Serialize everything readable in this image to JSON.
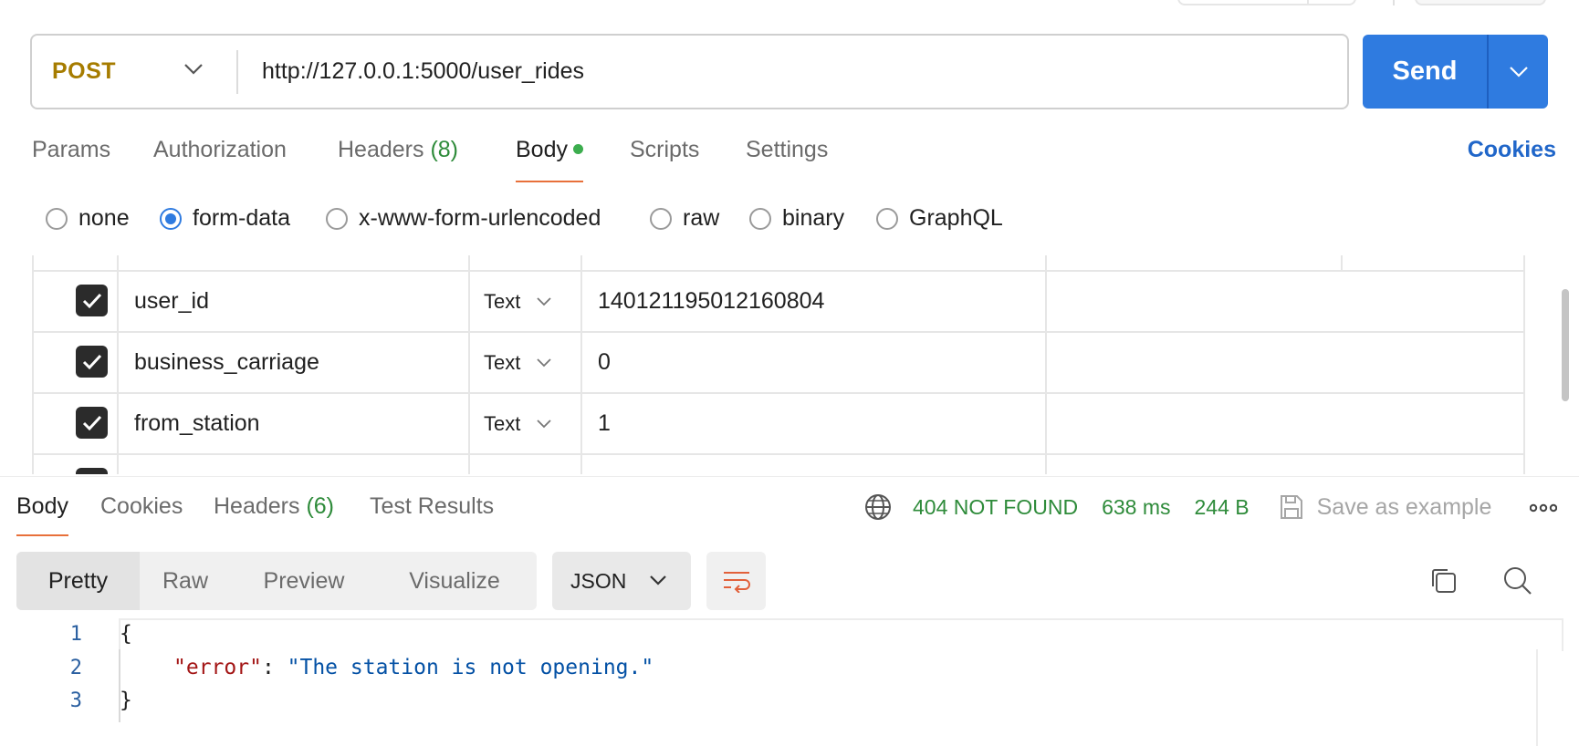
{
  "request": {
    "method": "POST",
    "url": "http://127.0.0.1:5000/user_rides",
    "send_label": "Send"
  },
  "req_tabs": {
    "params": "Params",
    "authorization": "Authorization",
    "headers": "Headers",
    "headers_count": "(8)",
    "body": "Body",
    "scripts": "Scripts",
    "settings": "Settings",
    "cookies": "Cookies"
  },
  "body_types": {
    "none": "none",
    "form_data": "form-data",
    "urlencoded": "x-www-form-urlencoded",
    "raw": "raw",
    "binary": "binary",
    "graphql": "GraphQL",
    "selected": "form-data"
  },
  "form_rows": [
    {
      "key": "user_id",
      "type": "Text",
      "value": "140121195012160804",
      "checked": true
    },
    {
      "key": "business_carriage",
      "type": "Text",
      "value": "0",
      "checked": true
    },
    {
      "key": "from_station",
      "type": "Text",
      "value": "1",
      "checked": true
    }
  ],
  "response": {
    "tabs": {
      "body": "Body",
      "cookies": "Cookies",
      "headers": "Headers",
      "headers_count": "(6)",
      "test_results": "Test Results"
    },
    "status": "404 NOT FOUND",
    "time": "638 ms",
    "size": "244 B",
    "save_example": "Save as example",
    "views": {
      "pretty": "Pretty",
      "raw": "Raw",
      "preview": "Preview",
      "visualize": "Visualize"
    },
    "format": "JSON",
    "code": {
      "line1": "1",
      "line2": "2",
      "line3": "3",
      "open_brace": "{",
      "close_brace": "}",
      "key": "\"error\"",
      "colon": ": ",
      "value": "\"The station is not opening.\""
    }
  },
  "colors": {
    "accent": "#2f7be0",
    "method": "#a67c00",
    "status_ok_text": "#2e8b3a",
    "tab_underline": "#e8703a",
    "cookies_link": "#2066c9"
  }
}
